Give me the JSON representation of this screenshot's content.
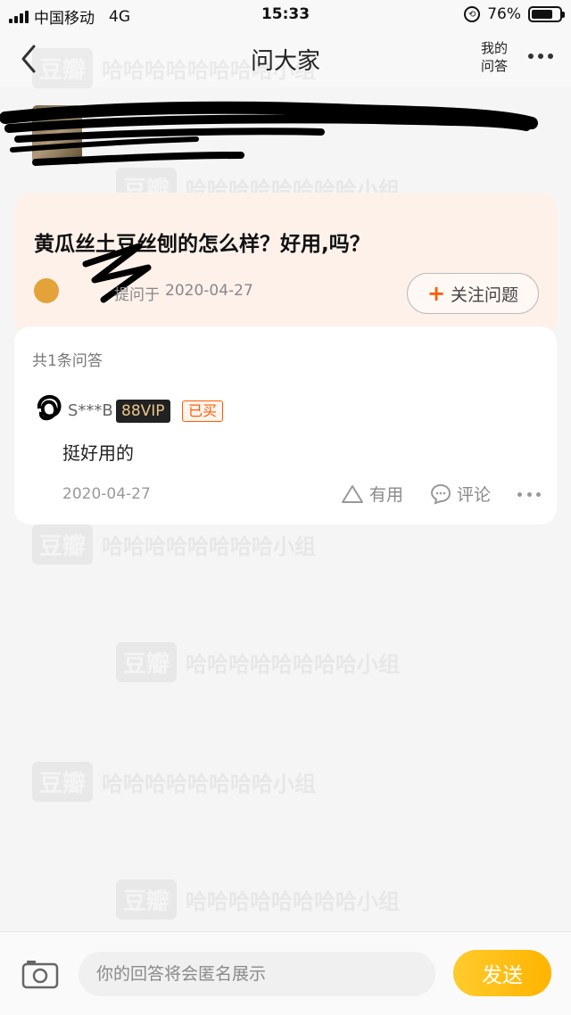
{
  "status_bar": {
    "carrier": "中国移动",
    "network": "4G",
    "time": "15:33",
    "battery_percent": "76%",
    "battery_level": 0.76
  },
  "nav": {
    "title": "问大家",
    "my_answers_label": "我的问答",
    "back_icon": "chevron-left-icon",
    "more_icon": "more-dots-icon"
  },
  "question": {
    "title": "黄瓜丝土豆丝刨的怎么样？好用,吗？",
    "asked_prefix": "提问于",
    "asked_date": "2020-04-27",
    "follow_label": "关注问题",
    "follow_icon": "plus-icon"
  },
  "answers": {
    "count_label": "共1条问答",
    "items": [
      {
        "name": "S***B",
        "vip": "88VIP",
        "bought_badge": "已买",
        "text": "挺好用的",
        "date": "2020-04-27",
        "useful_label": "有用",
        "comment_label": "评论"
      }
    ]
  },
  "watermark": {
    "logo": "豆瓣",
    "text": "哈哈哈哈哈哈哈哈小组"
  },
  "bottom": {
    "input_placeholder": "你的回答将会匿名展示",
    "send_label": "发送",
    "camera_icon": "camera-icon"
  },
  "colors": {
    "accent_orange": "#ff5a00",
    "send_yellow": "#ffbf1a",
    "question_bg": "#fdf1ea",
    "vip_gold": "#e7c58a"
  }
}
